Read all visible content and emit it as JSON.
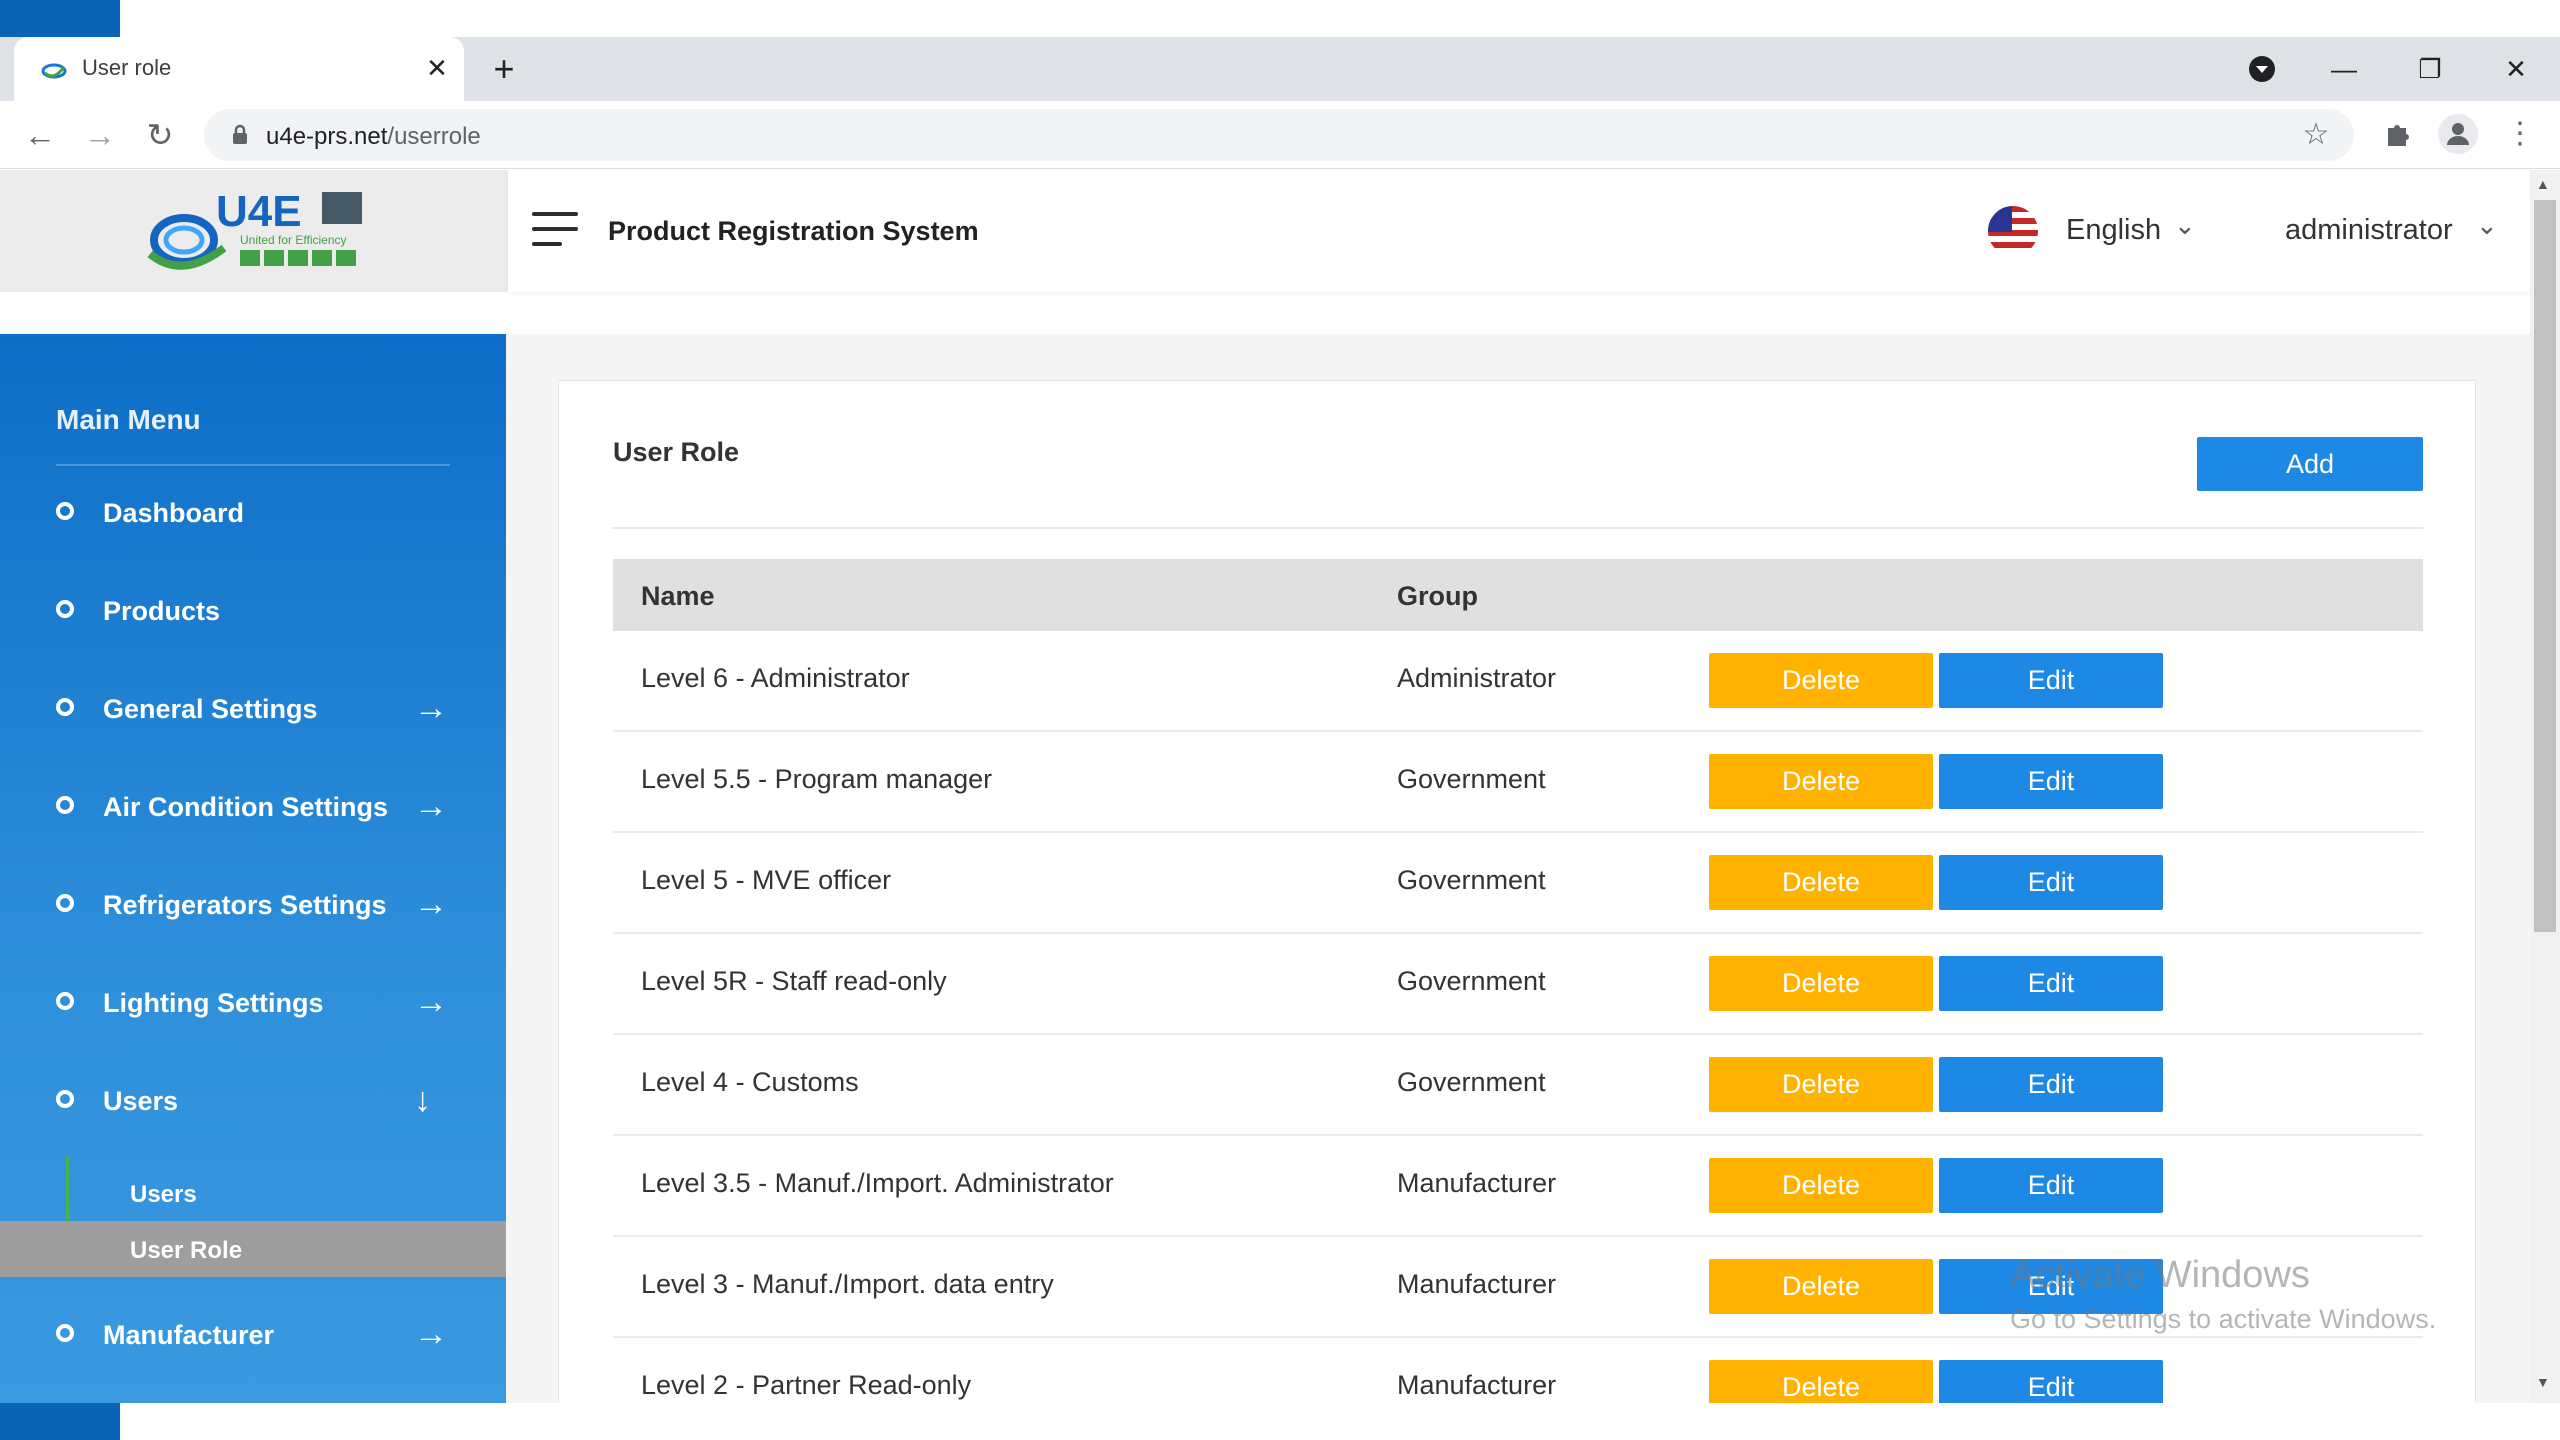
{
  "browser": {
    "tab_title": "User role",
    "url_host": "u4e-prs.net",
    "url_path": "/userrole"
  },
  "header": {
    "logo_text": "U4E",
    "logo_tagline": "United for Efficiency",
    "app_title": "Product Registration System",
    "language": "English",
    "user": "administrator"
  },
  "sidebar": {
    "title": "Main Menu",
    "items": [
      {
        "label": "Dashboard",
        "arrow": ""
      },
      {
        "label": "Products",
        "arrow": ""
      },
      {
        "label": "General Settings",
        "arrow": "→"
      },
      {
        "label": "Air Condition Settings",
        "arrow": "→"
      },
      {
        "label": "Refrigerators Settings",
        "arrow": "→"
      },
      {
        "label": "Lighting Settings",
        "arrow": "→"
      },
      {
        "label": "Users",
        "arrow": "↓"
      },
      {
        "label": "Manufacturer",
        "arrow": "→"
      }
    ],
    "subitems": [
      {
        "label": "Users",
        "active": false
      },
      {
        "label": "User Role",
        "active": true
      }
    ]
  },
  "main": {
    "title": "User Role",
    "add_label": "Add",
    "columns": [
      "Name",
      "Group"
    ],
    "delete_label": "Delete",
    "edit_label": "Edit",
    "rows": [
      {
        "name": "Level 6 - Administrator",
        "group": "Administrator"
      },
      {
        "name": "Level 5.5 - Program manager",
        "group": "Government"
      },
      {
        "name": "Level 5 - MVE officer",
        "group": "Government"
      },
      {
        "name": "Level 5R - Staff read-only",
        "group": "Government"
      },
      {
        "name": "Level 4 - Customs",
        "group": "Government"
      },
      {
        "name": "Level 3.5 - Manuf./Import. Administrator",
        "group": "Manufacturer"
      },
      {
        "name": "Level 3 - Manuf./Import. data entry",
        "group": "Manufacturer"
      },
      {
        "name": "Level 2 - Partner Read-only",
        "group": "Manufacturer"
      }
    ]
  },
  "watermark": {
    "title": "Activate Windows",
    "subtitle": "Go to Settings to activate Windows."
  },
  "colors": {
    "sidebar": "#0d6ec7",
    "primary_button": "#1e88e5",
    "delete_button": "#ffb300",
    "active_subitem": "#9e9e9e"
  }
}
